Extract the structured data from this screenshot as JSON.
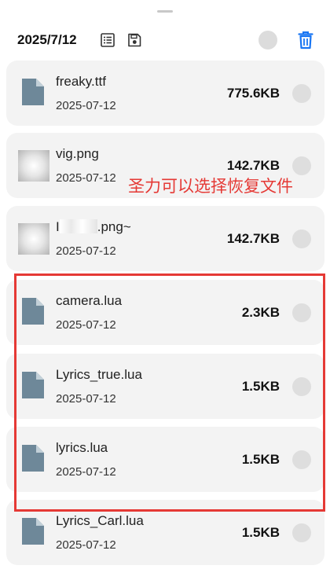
{
  "header": {
    "date": "2025/7/12",
    "icons": [
      "list-icon",
      "save-icon",
      "select-all-circle",
      "trash-icon"
    ],
    "accent_color": "#1976f3"
  },
  "files": [
    {
      "name": "freaky.ttf",
      "date": "2025-07-12",
      "size": "775.6KB",
      "icon": "file-icon"
    },
    {
      "name": "vig.png",
      "date": "2025-07-12",
      "size": "142.7KB",
      "icon": "image-thumbnail"
    },
    {
      "name_prefix": "I",
      "name_suffix": ".png~",
      "date": "2025-07-12",
      "size": "142.7KB",
      "icon": "image-thumbnail"
    },
    {
      "name": "camera.lua",
      "date": "2025-07-12",
      "size": "2.3KB",
      "icon": "file-icon"
    },
    {
      "name": "Lyrics_true.lua",
      "date": "2025-07-12",
      "size": "1.5KB",
      "icon": "file-icon"
    },
    {
      "name": "lyrics.lua",
      "date": "2025-07-12",
      "size": "1.5KB",
      "icon": "file-icon"
    },
    {
      "name": "Lyrics_Carl.lua",
      "date": "2025-07-12",
      "size": "1.5KB",
      "icon": "file-icon"
    }
  ],
  "annotation": {
    "text": "圣力可以选择恢复文件",
    "color": "#e53935"
  }
}
